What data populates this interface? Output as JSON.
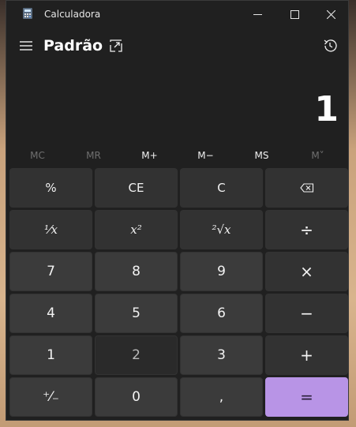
{
  "window": {
    "title": "Calculadora"
  },
  "header": {
    "mode": "Padrão"
  },
  "display": {
    "value": "1"
  },
  "memory": [
    {
      "label": "MC",
      "enabled": false
    },
    {
      "label": "MR",
      "enabled": false
    },
    {
      "label": "M+",
      "enabled": true
    },
    {
      "label": "M−",
      "enabled": true
    },
    {
      "label": "MS",
      "enabled": true
    },
    {
      "label": "M˅",
      "enabled": false
    }
  ],
  "keys": [
    {
      "label": "%",
      "name": "percent-key"
    },
    {
      "label": "CE",
      "name": "clear-entry-key"
    },
    {
      "label": "C",
      "name": "clear-key"
    },
    {
      "label": "",
      "name": "backspace-key",
      "icon": "backspace-icon"
    },
    {
      "label": "¹⁄x",
      "name": "reciprocal-key"
    },
    {
      "label": "x²",
      "name": "square-key"
    },
    {
      "label": "²√x",
      "name": "square-root-key"
    },
    {
      "label": "÷",
      "name": "divide-key"
    },
    {
      "label": "7",
      "name": "digit-7-key"
    },
    {
      "label": "8",
      "name": "digit-8-key"
    },
    {
      "label": "9",
      "name": "digit-9-key"
    },
    {
      "label": "×",
      "name": "multiply-key"
    },
    {
      "label": "4",
      "name": "digit-4-key"
    },
    {
      "label": "5",
      "name": "digit-5-key"
    },
    {
      "label": "6",
      "name": "digit-6-key"
    },
    {
      "label": "−",
      "name": "subtract-key"
    },
    {
      "label": "1",
      "name": "digit-1-key"
    },
    {
      "label": "2",
      "name": "digit-2-key"
    },
    {
      "label": "3",
      "name": "digit-3-key"
    },
    {
      "label": "+",
      "name": "add-key"
    },
    {
      "label": "⁺⁄₋",
      "name": "negate-key"
    },
    {
      "label": "0",
      "name": "digit-0-key"
    },
    {
      "label": ",",
      "name": "decimal-key"
    },
    {
      "label": "=",
      "name": "equals-key"
    }
  ],
  "colors": {
    "accent": "#b894e6",
    "window_bg": "#202020",
    "key_bg": "#3b3b3b"
  },
  "icons": [
    "calculator-app-icon",
    "minimize-icon",
    "maximize-icon",
    "close-icon",
    "hamburger-icon",
    "keep-on-top-icon",
    "history-icon",
    "backspace-icon"
  ]
}
